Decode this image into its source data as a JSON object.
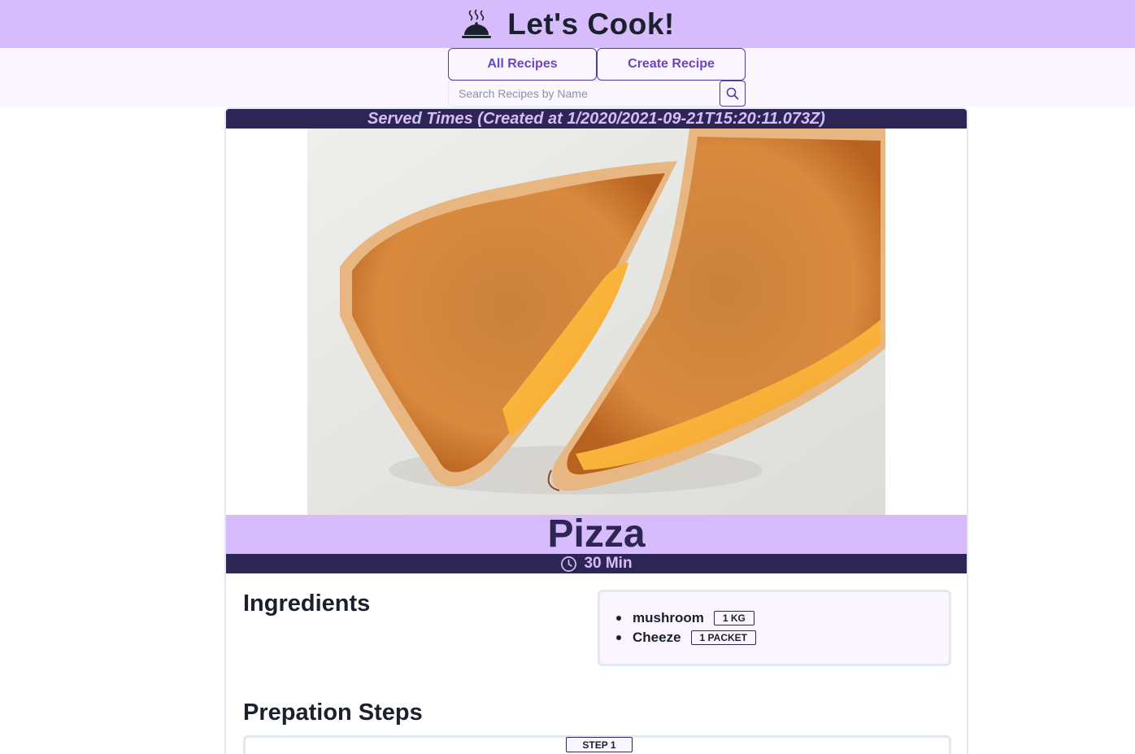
{
  "header": {
    "title": "Let's Cook!",
    "logo_icon": "cloche-icon"
  },
  "nav": {
    "all_recipes_label": "All Recipes",
    "create_recipe_label": "Create Recipe",
    "search_placeholder": "Search Recipes by Name",
    "search_icon": "search-icon"
  },
  "recipe": {
    "served_text": "Served Times (Created at 1/2020/2021-09-21T15:20:11.073Z)",
    "name": "Pizza",
    "time": "30 Min",
    "time_icon": "clock-icon",
    "ingredients_title": "Ingredients",
    "ingredients": [
      {
        "name": "mushroom",
        "qty": "1 KG"
      },
      {
        "name": "Cheeze",
        "qty": "1 PACKET"
      }
    ],
    "steps_title": "Prepation Steps",
    "steps": [
      {
        "label": "STEP 1"
      }
    ]
  },
  "colors": {
    "header_bg": "#d6bcfa",
    "nav_bg": "#faf5ff",
    "dark_band": "#2d2654",
    "accent_text": "#6b46c1"
  }
}
